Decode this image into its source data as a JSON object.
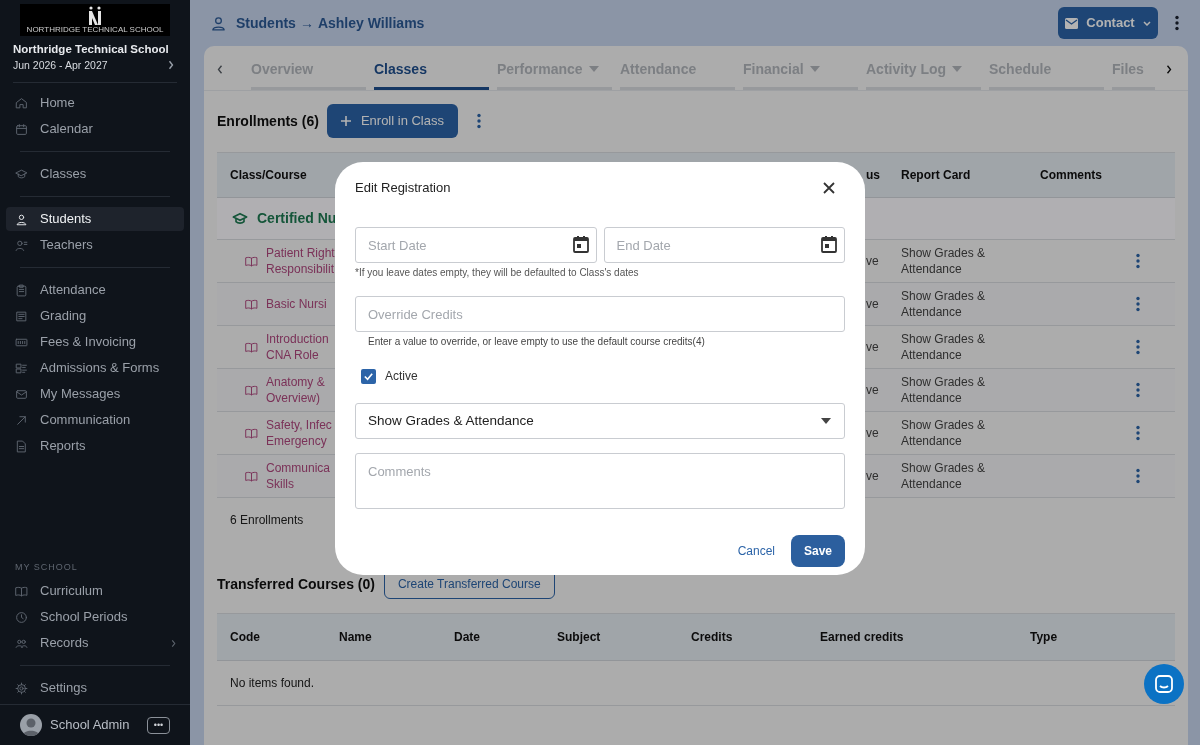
{
  "sidebar": {
    "logo_caption": "NORTHRIDGE TECHNICAL SCHOOL",
    "school": "Northridge Technical School",
    "period": "Jun 2026 - Apr 2027",
    "groups": [
      [
        {
          "label": "Home",
          "selected": false
        },
        {
          "label": "Calendar",
          "selected": false
        }
      ],
      [
        {
          "label": "Classes",
          "selected": false
        }
      ],
      [
        {
          "label": "Students",
          "selected": true
        },
        {
          "label": "Teachers",
          "selected": false
        }
      ],
      [
        {
          "label": "Attendance",
          "selected": false
        },
        {
          "label": "Grading",
          "selected": false
        },
        {
          "label": "Fees & Invoicing",
          "selected": false
        },
        {
          "label": "Admissions & Forms",
          "selected": false
        },
        {
          "label": "My Messages",
          "selected": false
        },
        {
          "label": "Communication",
          "selected": false
        },
        {
          "label": "Reports",
          "selected": false
        }
      ]
    ],
    "section_title": "MY SCHOOL",
    "school_items": [
      {
        "label": "Curriculum",
        "selected": false,
        "submenu": false
      },
      {
        "label": "School Periods",
        "selected": false,
        "submenu": false
      },
      {
        "label": "Records",
        "selected": false,
        "submenu": true
      }
    ],
    "settings": {
      "label": "Settings",
      "selected": false
    },
    "user": {
      "name": "School Admin",
      "menu": "•••"
    }
  },
  "header": {
    "section": "Students",
    "arrow": "→",
    "name": "Ashley Williams",
    "contact": "Contact"
  },
  "tabs": [
    {
      "label": "Overview",
      "selected": false,
      "dropdown": false
    },
    {
      "label": "Classes",
      "selected": true,
      "dropdown": false
    },
    {
      "label": "Performance",
      "selected": false,
      "dropdown": true
    },
    {
      "label": "Attendance",
      "selected": false,
      "dropdown": false
    },
    {
      "label": "Financial",
      "selected": false,
      "dropdown": true
    },
    {
      "label": "Activity Log",
      "selected": false,
      "dropdown": true
    },
    {
      "label": "Schedule",
      "selected": false,
      "dropdown": false
    },
    {
      "label": "Files",
      "selected": false,
      "dropdown": false
    }
  ],
  "enrollments": {
    "title": "Enrollments (6)",
    "button": "Enroll in Class",
    "columns": [
      "Class/Course",
      "us",
      "Report Card",
      "Comments"
    ],
    "group": "Certified Nu",
    "rows": [
      {
        "course": [
          "Patient Right",
          "Responsibilit"
        ],
        "status": "ve",
        "report_card": "Show Grades & Attendance"
      },
      {
        "course": [
          "Basic Nursi"
        ],
        "status": "ve",
        "report_card": "Show Grades & Attendance"
      },
      {
        "course": [
          "Introduction",
          "CNA Role"
        ],
        "status": "ve",
        "report_card": "Show Grades & Attendance"
      },
      {
        "course": [
          "Anatomy &",
          "Overview)"
        ],
        "status": "ve",
        "report_card": "Show Grades & Attendance"
      },
      {
        "course": [
          "Safety, Infec",
          "Emergency"
        ],
        "status": "ve",
        "report_card": "Show Grades & Attendance"
      },
      {
        "course": [
          "Communica",
          "Skills"
        ],
        "status": "ve",
        "report_card": "Show Grades & Attendance"
      }
    ],
    "footer": "6 Enrollments"
  },
  "transferred": {
    "title": "Transferred Courses (0)",
    "button": "Create Transferred Course",
    "columns": [
      "Code",
      "Name",
      "Date",
      "Subject",
      "Credits",
      "Earned credits",
      "Type"
    ],
    "empty": "No items found."
  },
  "modal": {
    "title": "Edit Registration",
    "start_placeholder": "Start Date",
    "end_placeholder": "End Date",
    "dates_hint": "*If you leave dates empty, they will be defaulted to Class's dates",
    "credits_placeholder": "Override Credits",
    "credits_hint": "Enter a value to override, or leave empty to use the default course credits(4)",
    "active": {
      "label": "Active",
      "checked": true
    },
    "report_card": "Show Grades & Attendance",
    "comments_placeholder": "Comments",
    "cancel": "Cancel",
    "save": "Save"
  }
}
